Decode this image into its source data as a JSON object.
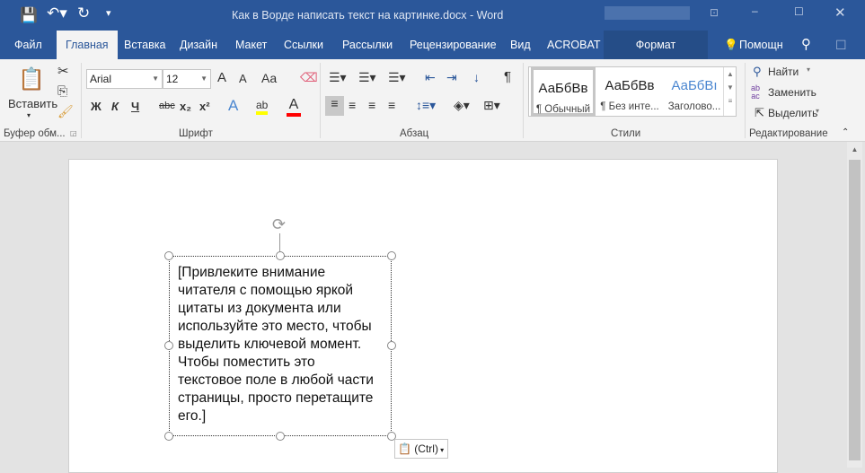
{
  "title": "Как в Ворде написать текст на картинке.docx - Word",
  "quick_access": {
    "save": "save-icon",
    "undo": "undo-icon",
    "redo": "redo-icon",
    "customize": "customize-icon"
  },
  "window_controls": [
    "ribbon-display-icon",
    "minimize-icon",
    "maximize-icon",
    "close-icon"
  ],
  "tabs": [
    "Файл",
    "Главная",
    "Вставка",
    "Дизайн",
    "Макет",
    "Ссылки",
    "Рассылки",
    "Рецензирование",
    "Вид",
    "ACROBAT",
    "Формат"
  ],
  "active_tab": "Главная",
  "help": "Помощн",
  "clipboard": {
    "paste": "Вставить",
    "label": "Буфер обм..."
  },
  "font": {
    "name": "Arial",
    "size": "12",
    "bold": "Ж",
    "italic": "К",
    "underline": "Ч",
    "strike": "abc",
    "sub": "x₂",
    "sup": "x²",
    "grow": "A",
    "shrink": "A",
    "case": "Aa",
    "label": "Шрифт",
    "highlight_color": "#ffff00",
    "font_color": "#ff0000"
  },
  "paragraph": {
    "label": "Абзац",
    "pilcrow": "¶"
  },
  "styles": {
    "label": "Стили",
    "items": [
      {
        "sample": "АаБбВв",
        "name": "¶ Обычный"
      },
      {
        "sample": "АаБбВв",
        "name": "¶ Без инте..."
      },
      {
        "sample": "АаБбВı",
        "name": "Заголово..."
      }
    ]
  },
  "editing": {
    "label": "Редактирование",
    "find": "Найти",
    "replace": "Заменить",
    "select": "Выделить"
  },
  "textbox": {
    "lines": [
      "[Привлеките внимание",
      "читателя с помощью яркой",
      "цитаты из документа или",
      "используйте это место, чтобы",
      "выделить ключевой момент.",
      "Чтобы поместить это",
      "текстовое поле в любой части",
      "страницы, просто перетащите",
      "его.]"
    ]
  },
  "paste_options": "(Ctrl)",
  "colors": {
    "brand": "#2b579a",
    "ribbon": "#f3f3f3"
  }
}
